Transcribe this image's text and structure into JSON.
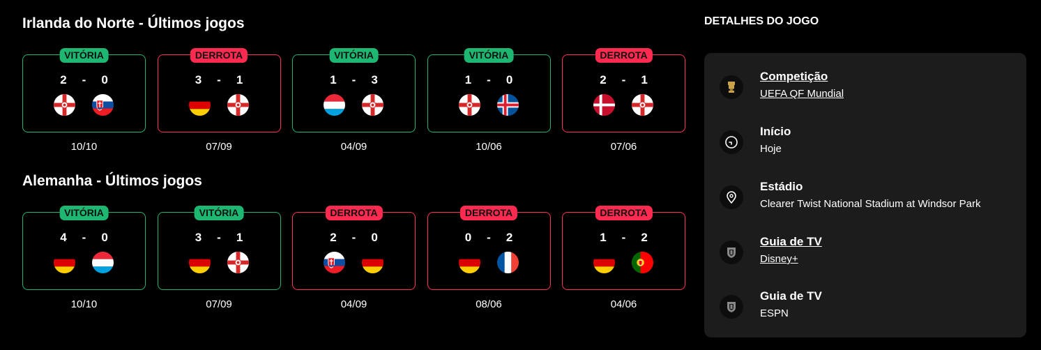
{
  "section1": {
    "title": "Irlanda do Norte - Últimos jogos",
    "games": [
      {
        "result": "VITÓRIA",
        "outcome": "win",
        "home_score": "2",
        "sep": "-",
        "away_score": "0",
        "home_flag": "northern-ireland-flag",
        "away_flag": "slovakia-flag",
        "date": "10/10"
      },
      {
        "result": "DERROTA",
        "outcome": "loss",
        "home_score": "3",
        "sep": "-",
        "away_score": "1",
        "home_flag": "germany-flag",
        "away_flag": "northern-ireland-flag",
        "date": "07/09"
      },
      {
        "result": "VITÓRIA",
        "outcome": "win",
        "home_score": "1",
        "sep": "-",
        "away_score": "3",
        "home_flag": "luxembourg-flag",
        "away_flag": "northern-ireland-flag",
        "date": "04/09"
      },
      {
        "result": "VITÓRIA",
        "outcome": "win",
        "home_score": "1",
        "sep": "-",
        "away_score": "0",
        "home_flag": "northern-ireland-flag",
        "away_flag": "iceland-flag",
        "date": "10/06"
      },
      {
        "result": "DERROTA",
        "outcome": "loss",
        "home_score": "2",
        "sep": "-",
        "away_score": "1",
        "home_flag": "denmark-flag",
        "away_flag": "northern-ireland-flag",
        "date": "07/06"
      }
    ]
  },
  "section2": {
    "title": "Alemanha - Últimos jogos",
    "games": [
      {
        "result": "VITÓRIA",
        "outcome": "win",
        "home_score": "4",
        "sep": "-",
        "away_score": "0",
        "home_flag": "germany-flag",
        "away_flag": "luxembourg-flag",
        "date": "10/10"
      },
      {
        "result": "VITÓRIA",
        "outcome": "win",
        "home_score": "3",
        "sep": "-",
        "away_score": "1",
        "home_flag": "germany-flag",
        "away_flag": "northern-ireland-flag",
        "date": "07/09"
      },
      {
        "result": "DERROTA",
        "outcome": "loss",
        "home_score": "2",
        "sep": "-",
        "away_score": "0",
        "home_flag": "slovakia-flag",
        "away_flag": "germany-flag",
        "date": "04/09"
      },
      {
        "result": "DERROTA",
        "outcome": "loss",
        "home_score": "0",
        "sep": "-",
        "away_score": "2",
        "home_flag": "germany-flag",
        "away_flag": "france-flag",
        "date": "08/06"
      },
      {
        "result": "DERROTA",
        "outcome": "loss",
        "home_score": "1",
        "sep": "-",
        "away_score": "2",
        "home_flag": "germany-flag",
        "away_flag": "portugal-flag",
        "date": "04/06"
      }
    ]
  },
  "details": {
    "header": "DETALHES DO JOGO",
    "rows": [
      {
        "icon": "trophy-icon",
        "label": "Competição",
        "value": "UEFA QF Mundial",
        "link": true
      },
      {
        "icon": "clock-icon",
        "label": "Início",
        "value": "Hoje",
        "link": false
      },
      {
        "icon": "location-pin-icon",
        "label": "Estádio",
        "value": "Clearer Twist National Stadium at Windsor Park",
        "link": false
      },
      {
        "icon": "tv-guide-icon",
        "label": "Guia de TV",
        "value": "Disney+",
        "link": true
      },
      {
        "icon": "tv-guide-icon",
        "label": "Guia de TV",
        "value": "ESPN",
        "link": false
      }
    ]
  },
  "colors": {
    "win": "#1eb772",
    "loss": "#ff2a50",
    "panel_bg": "#1c1c1c",
    "page_bg": "#000000"
  }
}
